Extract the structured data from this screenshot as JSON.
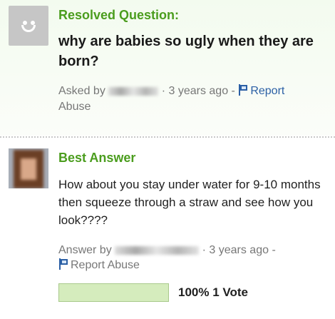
{
  "question": {
    "heading": "Resolved Question:",
    "title": "why are babies so ugly when they are born?",
    "asked_by_label": "Asked by",
    "time": "· 3 years ago -",
    "report_label_1": "Report",
    "report_label_2": "Abuse"
  },
  "answer": {
    "heading": "Best Answer",
    "text": "How about you stay under water for 9-10 months then squeeze through a straw and see how you look????",
    "answer_by_label": "Answer by",
    "time": "· 3 years ago -",
    "report_label": "Report Abuse",
    "vote_percent": "100%",
    "vote_count": "1 Vote",
    "vote_fraction": 1.0
  },
  "icons": {
    "question_avatar": "default-smiley-avatar-icon",
    "report_flag": "flag-icon"
  },
  "colors": {
    "heading": "#4b9d1e",
    "link": "#2b5fa5",
    "vote_bar": "#d5ecbd"
  }
}
